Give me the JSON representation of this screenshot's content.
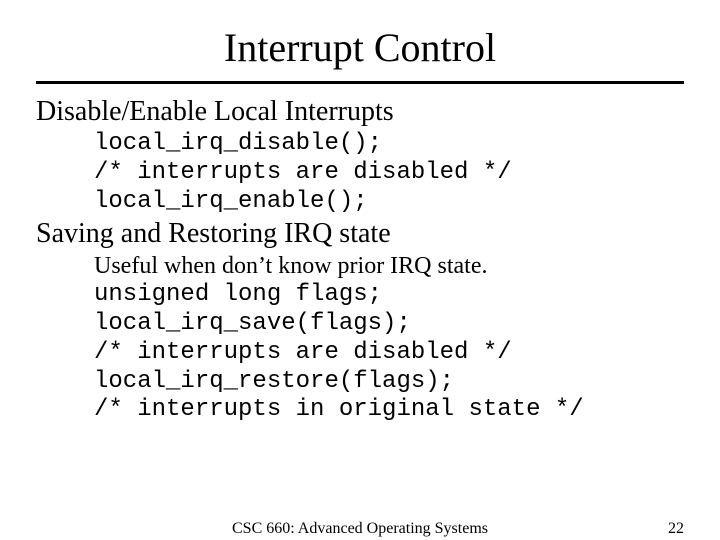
{
  "title": "Interrupt Control",
  "section1": {
    "heading": "Disable/Enable Local Interrupts",
    "code": "local_irq_disable();\n/* interrupts are disabled */\nlocal_irq_enable();"
  },
  "section2": {
    "heading": "Saving and Restoring IRQ state",
    "note": "Useful when don’t know prior IRQ state.",
    "code": "unsigned long flags;\nlocal_irq_save(flags);\n/* interrupts are disabled */\nlocal_irq_restore(flags);\n/* interrupts in original state */"
  },
  "footer": {
    "course": "CSC 660: Advanced Operating Systems",
    "page": "22"
  }
}
